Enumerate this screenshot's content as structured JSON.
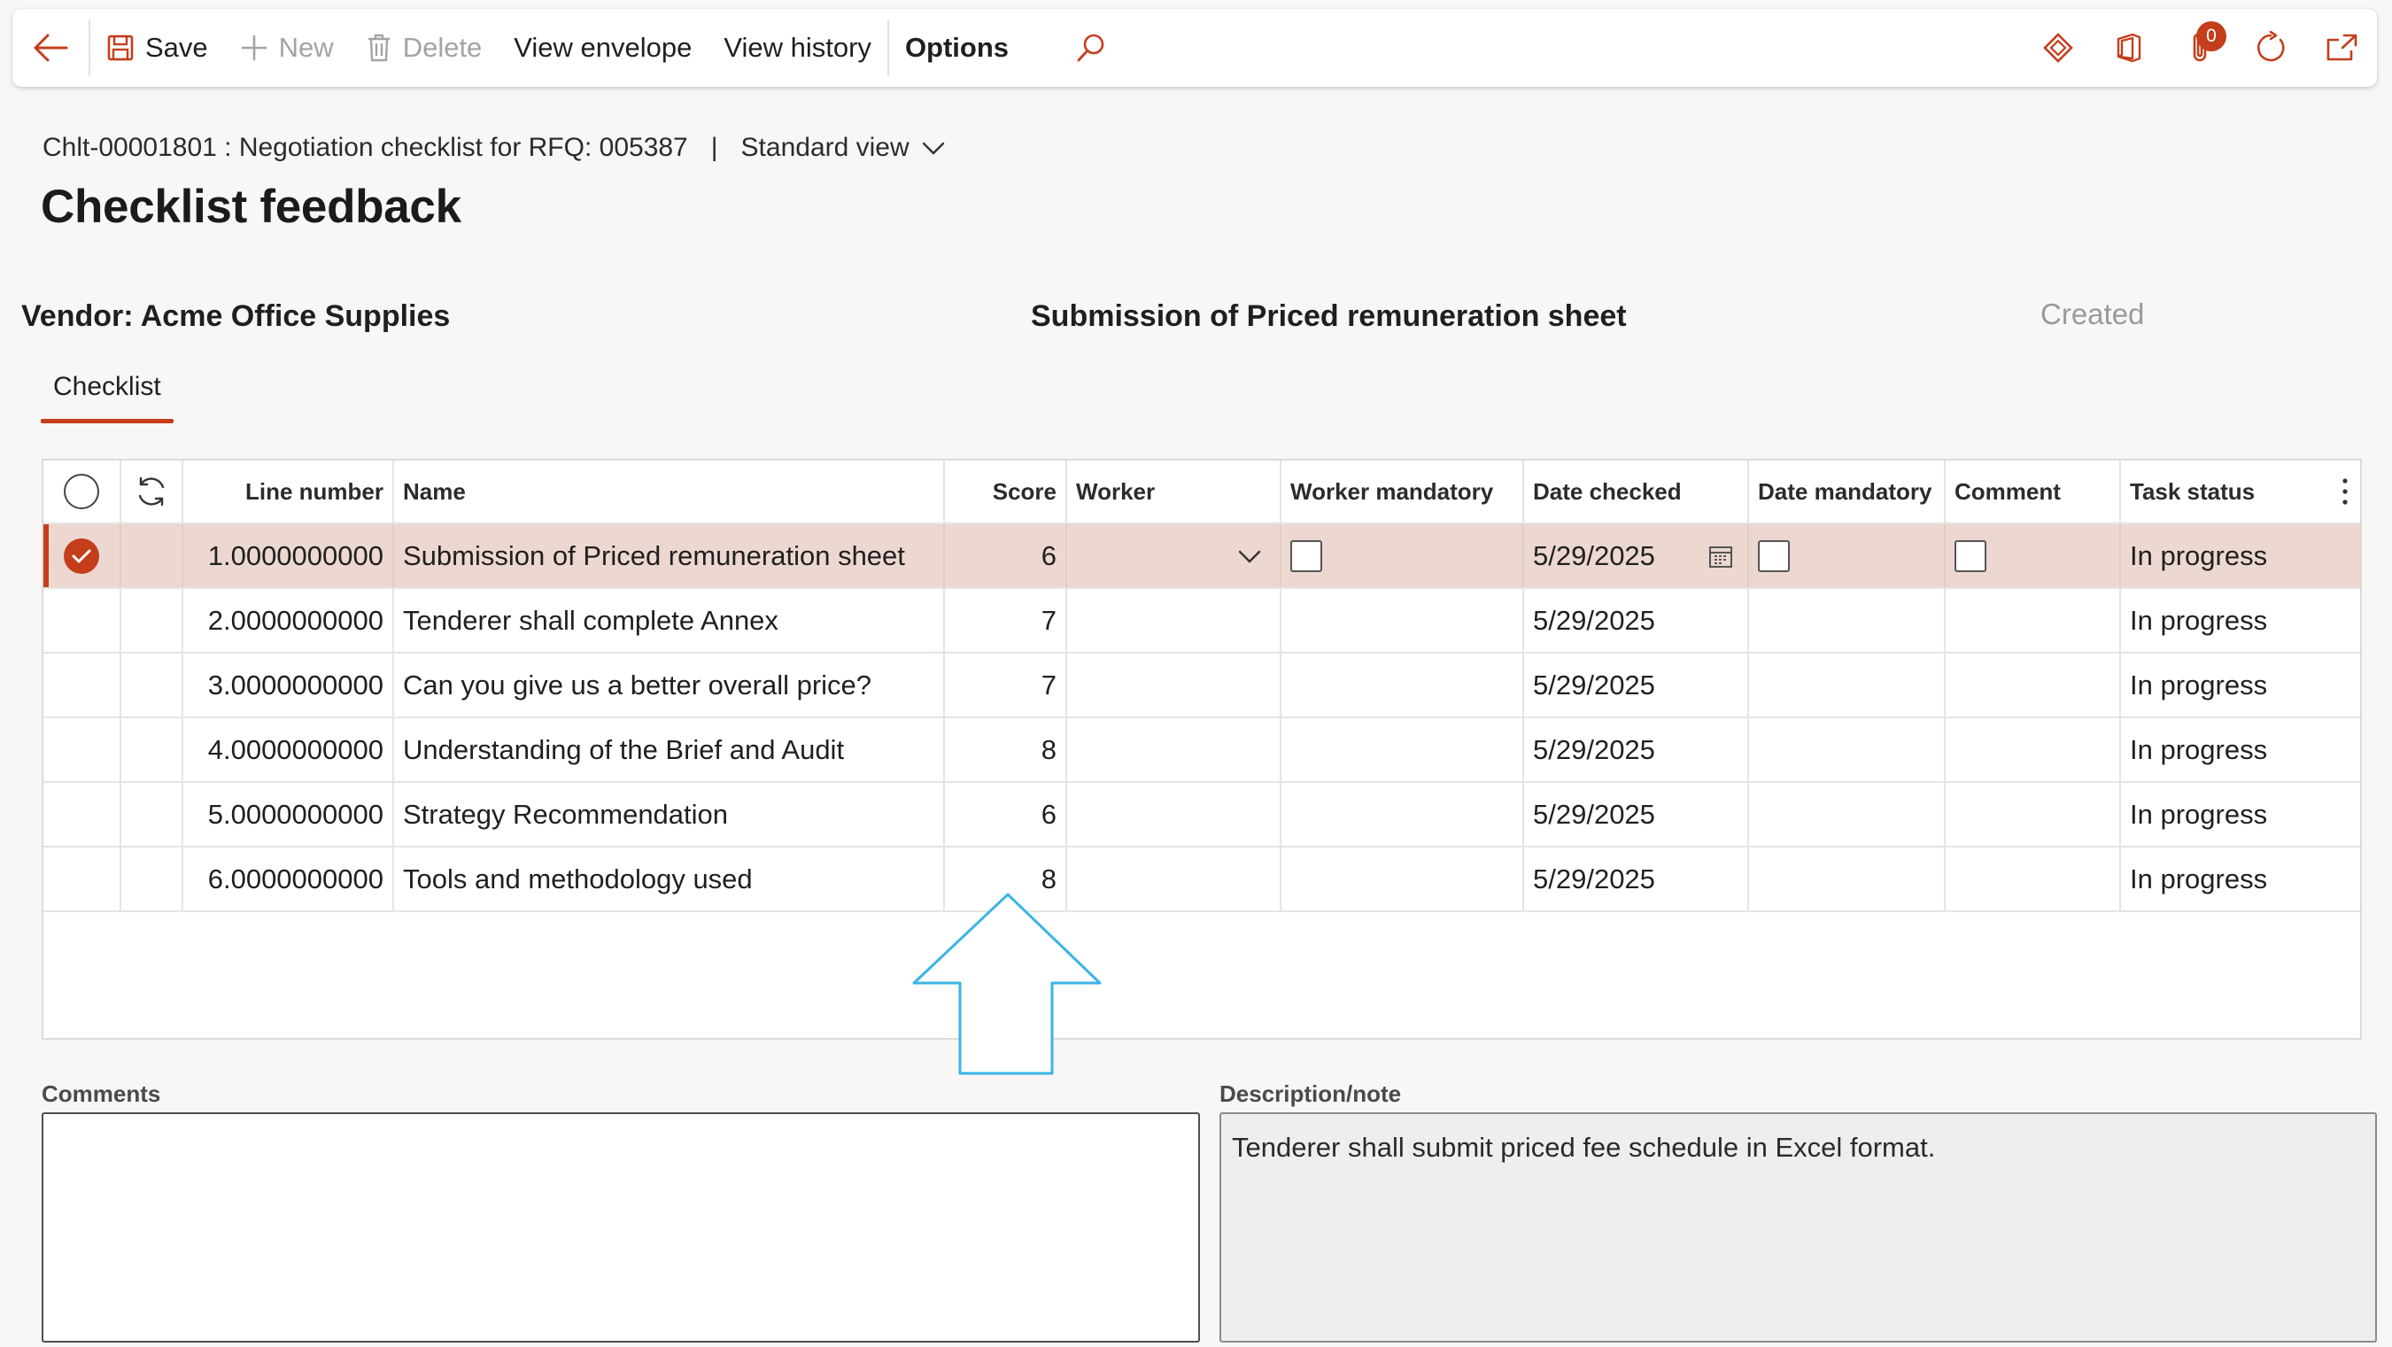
{
  "toolbar": {
    "save": "Save",
    "new": "New",
    "delete": "Delete",
    "view_envelope": "View envelope",
    "view_history": "View history",
    "options": "Options",
    "notifications_count": "0"
  },
  "header": {
    "record": "Chlt-00001801 : Negotiation checklist for RFQ: 005387",
    "separator": "|",
    "view_name": "Standard view",
    "title": "Checklist feedback"
  },
  "summary": {
    "vendor": "Vendor: Acme Office Supplies",
    "checklist_item": "Submission of Priced remuneration sheet",
    "status": "Created"
  },
  "tabs": [
    {
      "label": "Checklist",
      "active": true
    }
  ],
  "grid": {
    "columns": {
      "line_number": "Line number",
      "name": "Name",
      "score": "Score",
      "worker": "Worker",
      "worker_mandatory": "Worker mandatory",
      "date_checked": "Date checked",
      "date_mandatory": "Date mandatory",
      "comment": "Comment",
      "task_status": "Task status"
    },
    "rows": [
      {
        "line": "1.0000000000",
        "name": "Submission of Priced remuneration sheet",
        "score": "6",
        "date": "5/29/2025",
        "status": "In progress"
      },
      {
        "line": "2.0000000000",
        "name": "Tenderer shall complete Annex",
        "score": "7",
        "date": "5/29/2025",
        "status": "In progress"
      },
      {
        "line": "3.0000000000",
        "name": "Can you give us a better overall price?",
        "score": "7",
        "date": "5/29/2025",
        "status": "In progress"
      },
      {
        "line": "4.0000000000",
        "name": "Understanding of the Brief and Audit",
        "score": "8",
        "date": "5/29/2025",
        "status": "In progress"
      },
      {
        "line": "5.0000000000",
        "name": "Strategy Recommendation",
        "score": "6",
        "date": "5/29/2025",
        "status": "In progress"
      },
      {
        "line": "6.0000000000",
        "name": "Tools and methodology used",
        "score": "8",
        "date": "5/29/2025",
        "status": "In progress"
      }
    ],
    "selected_row": 0
  },
  "comments": {
    "label": "Comments",
    "value": ""
  },
  "description": {
    "label": "Description/note",
    "value": "Tenderer shall submit priced fee schedule in Excel format."
  },
  "colors": {
    "accent": "#c43e1c",
    "selected_row": "#ecd7d1",
    "callout_arrow": "#3ab4e6"
  }
}
